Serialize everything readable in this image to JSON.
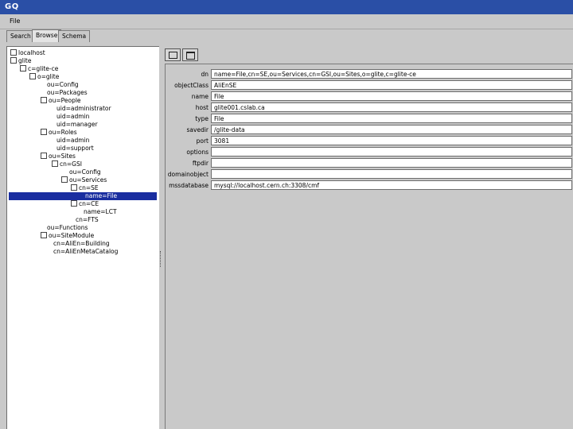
{
  "window": {
    "title": "GQ"
  },
  "menu": {
    "file": "File"
  },
  "tabs": [
    {
      "label": "Search"
    },
    {
      "label": "Browse"
    },
    {
      "label": "Schema"
    }
  ],
  "tree": [
    {
      "label": "localhost"
    },
    {
      "label": "glite"
    },
    {
      "label": "c=glite-ce"
    },
    {
      "label": "o=glite"
    },
    {
      "label": "ou=Config"
    },
    {
      "label": "ou=Packages"
    },
    {
      "label": "ou=People"
    },
    {
      "label": "uid=administrator"
    },
    {
      "label": "uid=admin"
    },
    {
      "label": "uid=manager"
    },
    {
      "label": "ou=Roles"
    },
    {
      "label": "uid=admin"
    },
    {
      "label": "uid=support"
    },
    {
      "label": "ou=Sites"
    },
    {
      "label": "cn=GSI"
    },
    {
      "label": "ou=Config"
    },
    {
      "label": "ou=Services"
    },
    {
      "label": "cn=SE"
    },
    {
      "label": "name=File"
    },
    {
      "label": "cn=CE"
    },
    {
      "label": "name=LCT"
    },
    {
      "label": "cn=FTS"
    },
    {
      "label": "ou=Functions"
    },
    {
      "label": "ou=SiteModule"
    },
    {
      "label": "cn=AliEn=Building"
    },
    {
      "label": "cn=AliEnMetaCatalog"
    }
  ],
  "form": {
    "fields": [
      {
        "label": "dn",
        "value": "name=File,cn=SE,ou=Services,cn=GSI,ou=Sites,o=glite,c=glite-ce"
      },
      {
        "label": "objectClass",
        "value": "AliEnSE"
      },
      {
        "label": "name",
        "value": "File"
      },
      {
        "label": "host",
        "value": "glite001.cslab.ca"
      },
      {
        "label": "type",
        "value": "File"
      },
      {
        "label": "savedir",
        "value": "/glite-data"
      },
      {
        "label": "port",
        "value": "3081"
      },
      {
        "label": "options",
        "value": ""
      },
      {
        "label": "ftpdir",
        "value": ""
      },
      {
        "label": "domainobject",
        "value": ""
      },
      {
        "label": "mssdatabase",
        "value": "mysql://localhost.cern.ch:3308/cmf"
      }
    ]
  }
}
